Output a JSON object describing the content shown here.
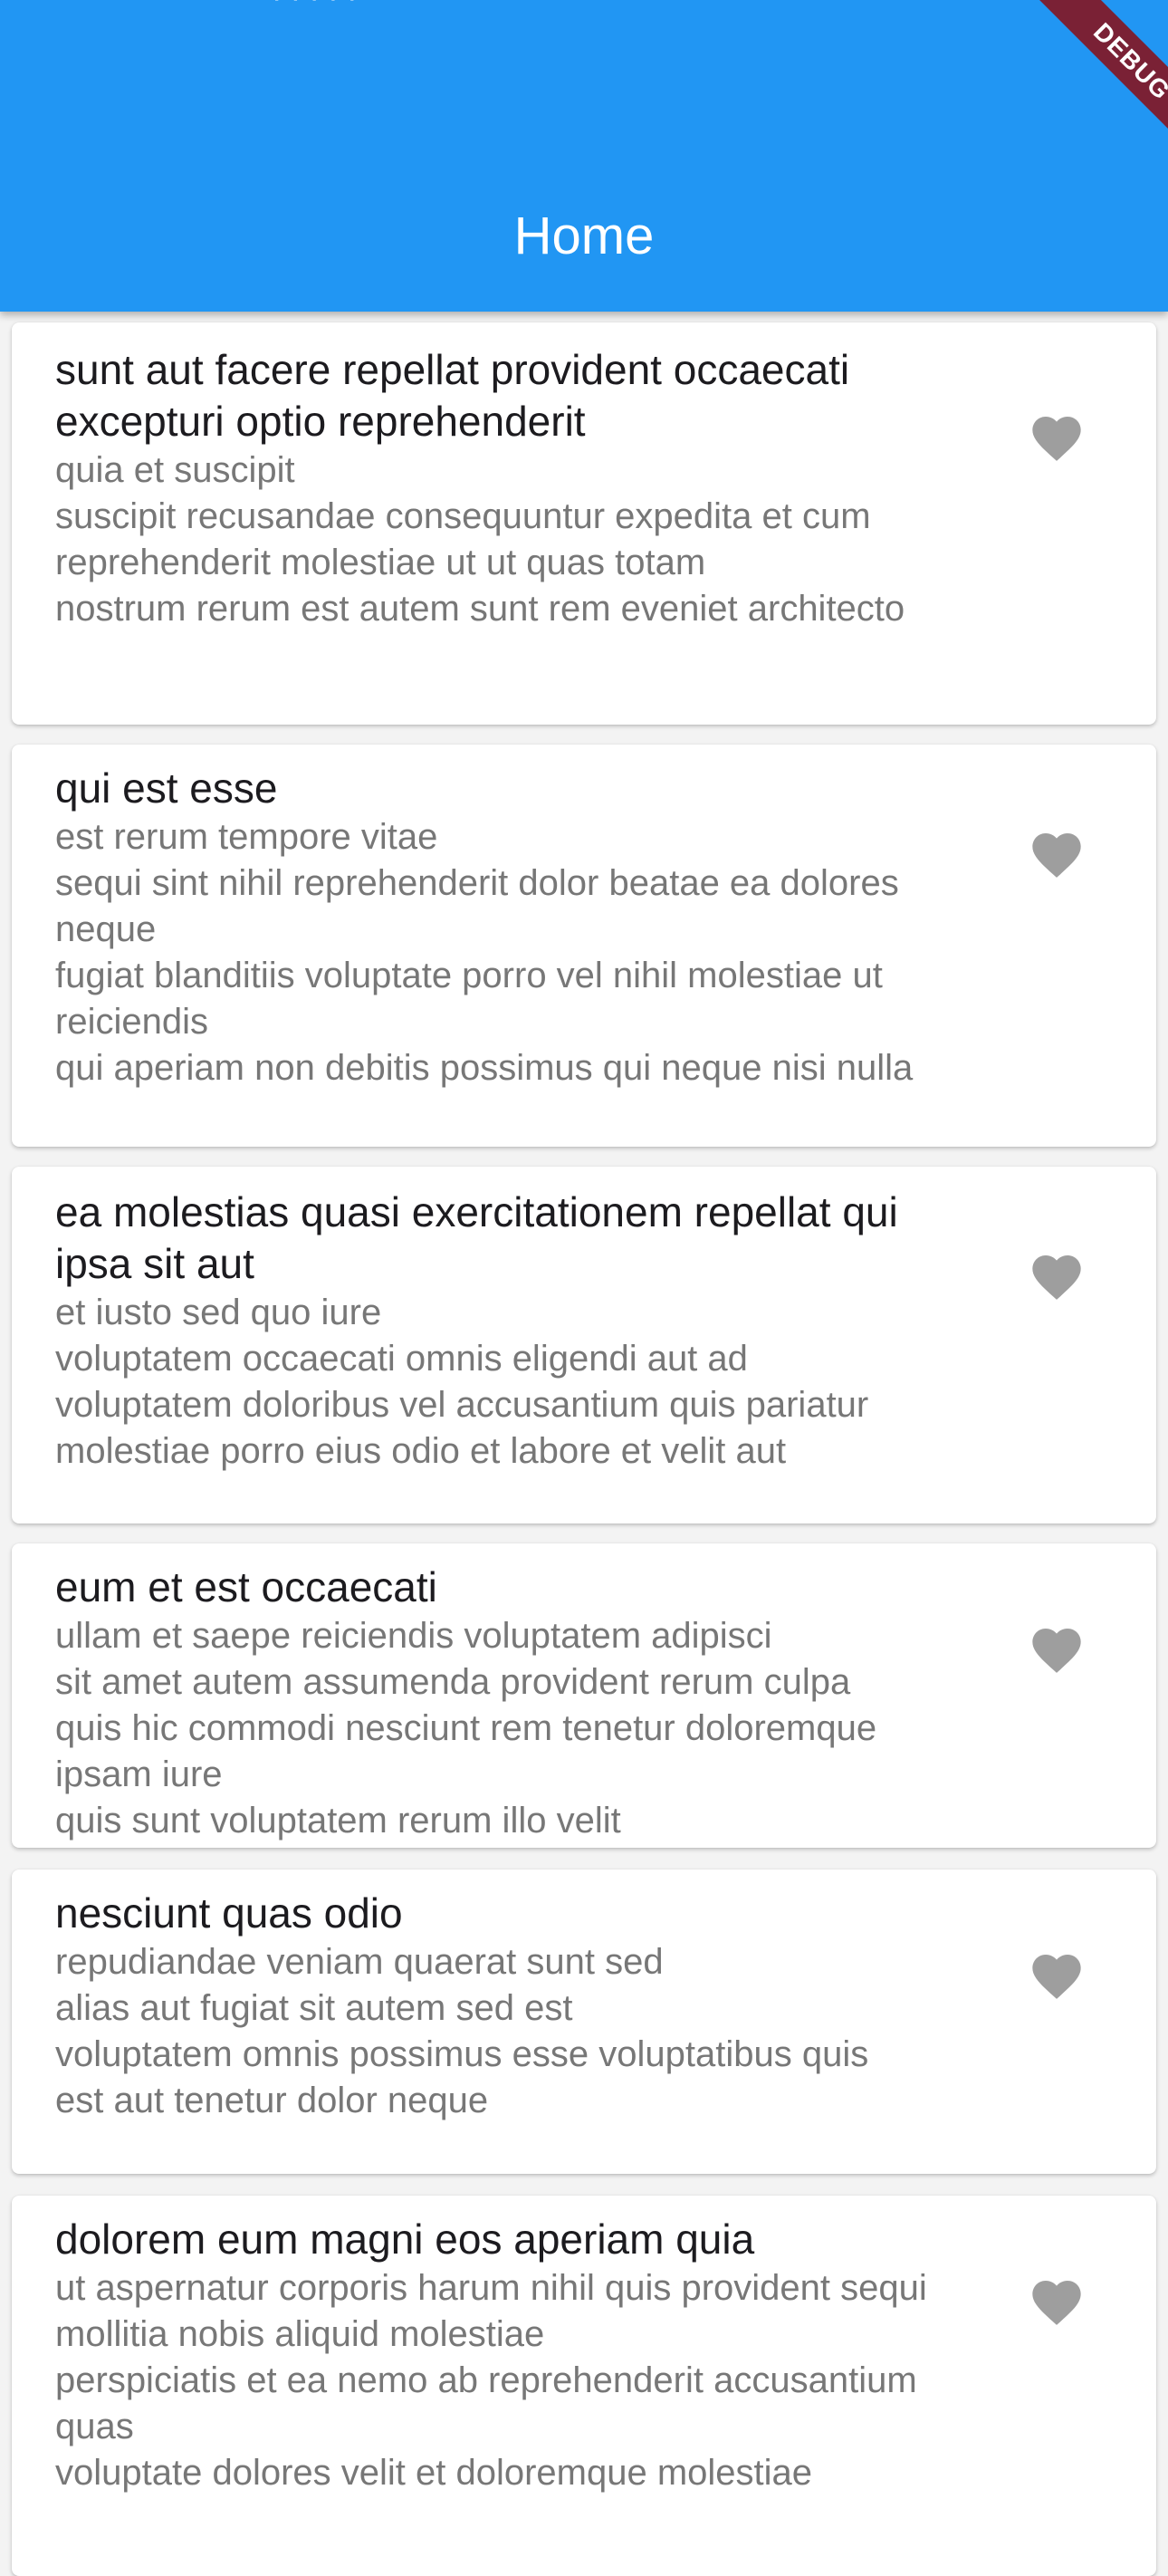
{
  "appbar": {
    "title": "Home",
    "status_remnant": "· · · · ·",
    "background": "#2196f3",
    "debug_label": "DEBUG"
  },
  "colors": {
    "card_background": "#ffffff",
    "title_text": "#1c1b1f",
    "body_text": "#777777",
    "heart_icon": "#9e9e9e",
    "debug_banner": "#7a2135"
  },
  "posts": [
    {
      "title": "sunt aut facere repellat provident occaecati excepturi optio reprehenderit",
      "body": "quia et suscipit\nsuscipit recusandae consequuntur expedita et cum\nreprehenderit molestiae ut ut quas totam\nnostrum rerum est autem sunt rem eveniet architecto",
      "icon": "heart-icon"
    },
    {
      "title": "qui est esse",
      "body": "est rerum tempore vitae\nsequi sint nihil reprehenderit dolor beatae ea dolores neque\nfugiat blanditiis voluptate porro vel nihil molestiae ut reiciendis\nqui aperiam non debitis possimus qui neque nisi nulla",
      "icon": "heart-icon"
    },
    {
      "title": "ea molestias quasi exercitationem repellat qui ipsa sit aut",
      "body": "et iusto sed quo iure\nvoluptatem occaecati omnis eligendi aut ad\nvoluptatem doloribus vel accusantium quis pariatur\nmolestiae porro eius odio et labore et velit aut",
      "icon": "heart-icon"
    },
    {
      "title": "eum et est occaecati",
      "body": "ullam et saepe reiciendis voluptatem adipisci\nsit amet autem assumenda provident rerum culpa\nquis hic commodi nesciunt rem tenetur doloremque ipsam iure\nquis sunt voluptatem rerum illo velit",
      "icon": "heart-icon"
    },
    {
      "title": "nesciunt quas odio",
      "body": "repudiandae veniam quaerat sunt sed\nalias aut fugiat sit autem sed est\nvoluptatem omnis possimus esse voluptatibus quis\nest aut tenetur dolor neque",
      "icon": "heart-icon"
    },
    {
      "title": "dolorem eum magni eos aperiam quia",
      "body": "ut aspernatur corporis harum nihil quis provident sequi\nmollitia nobis aliquid molestiae\nperspiciatis et ea nemo ab reprehenderit accusantium quas\nvoluptate dolores velit et doloremque molestiae",
      "icon": "heart-icon"
    }
  ]
}
